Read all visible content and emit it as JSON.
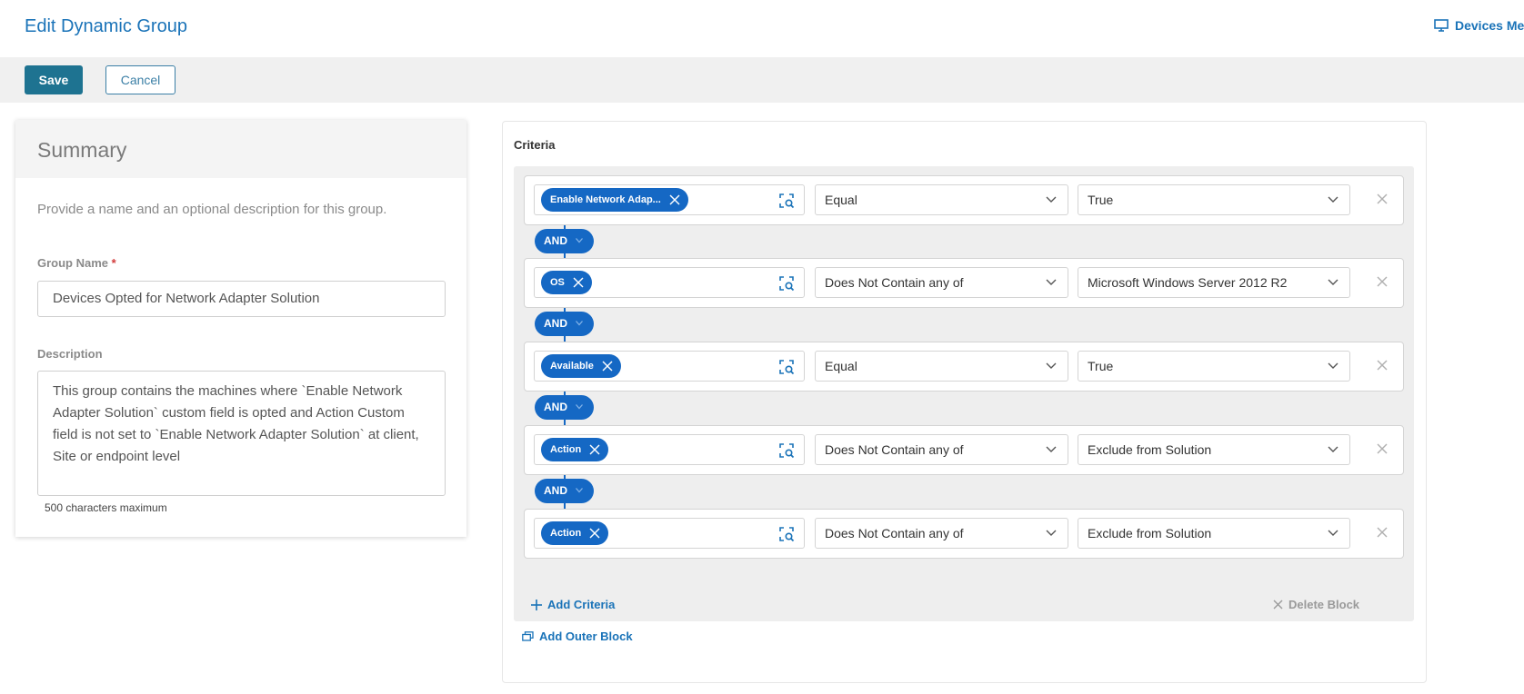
{
  "header": {
    "title": "Edit Dynamic Group",
    "devices_link": "Devices Me",
    "devices_icon": "monitor-icon"
  },
  "toolbar": {
    "save_label": "Save",
    "cancel_label": "Cancel"
  },
  "summary": {
    "title": "Summary",
    "description": "Provide a name and an optional description for this group.",
    "group_name_label": "Group Name",
    "required_marker": "*",
    "group_name_value": "Devices Opted for Network Adapter Solution",
    "description_label": "Description",
    "description_value": "This group contains the machines where `Enable Network Adapter Solution` custom field is opted and Action Custom field is not set to `Enable Network Adapter Solution` at client, Site or endpoint level",
    "char_hint": "500 characters maximum"
  },
  "criteria": {
    "label": "Criteria",
    "rows": [
      {
        "field": "Enable Network Adap...",
        "operator": "Equal",
        "value": "True"
      },
      {
        "field": "OS",
        "operator": "Does Not Contain any of",
        "value": "Microsoft Windows Server 2012 R2"
      },
      {
        "field": "Available",
        "operator": "Equal",
        "value": "True"
      },
      {
        "field": "Action",
        "operator": "Does Not Contain any of",
        "value": "Exclude from Solution"
      },
      {
        "field": "Action",
        "operator": "Does Not Contain any of",
        "value": "Exclude from Solution"
      }
    ],
    "joins": [
      "AND",
      "AND",
      "AND",
      "AND"
    ],
    "add_criteria": "Add Criteria",
    "delete_block": "Delete Block",
    "add_outer_block": "Add Outer Block"
  },
  "colors": {
    "accent": "#1568c4",
    "save_bg": "#1e7391",
    "link": "#1a73b8"
  }
}
